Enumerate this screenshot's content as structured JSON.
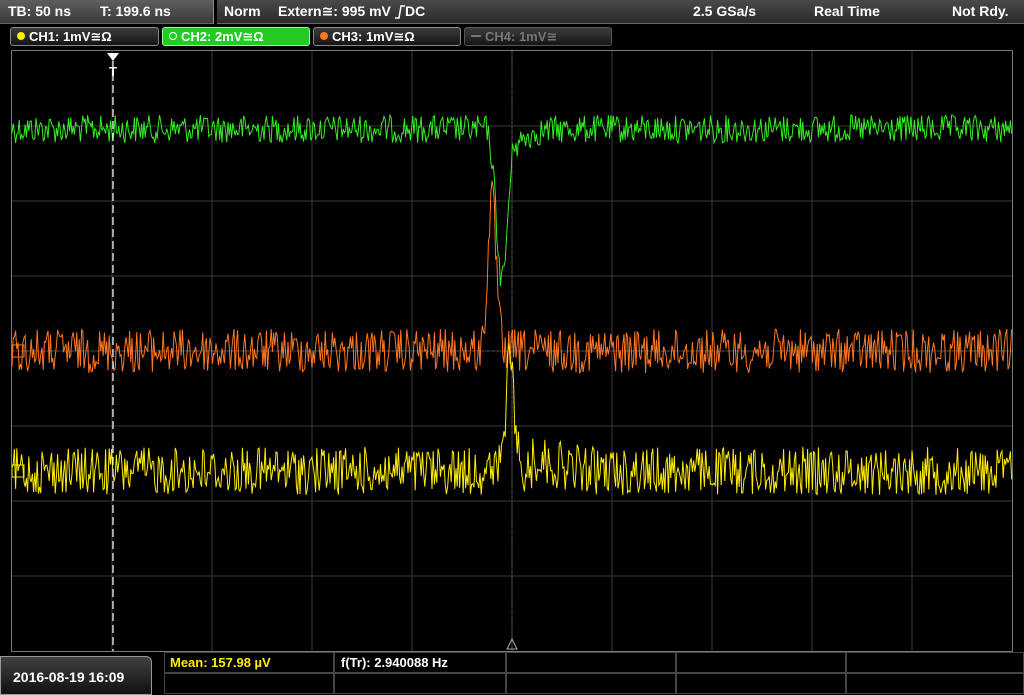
{
  "status": {
    "timebase": "TB: 50 ns",
    "trigger_time": "T: 199.6 ns",
    "mode": "Norm",
    "trigger_source": "Extern≅: 995 mV",
    "trigger_slope_coupling": "DC",
    "sample_rate": "2.5 GSa/s",
    "acq_mode": "Real Time",
    "state": "Not Rdy."
  },
  "channels": [
    {
      "label": "CH1: 1mV≅Ω",
      "color": "#ffee00",
      "active": false,
      "enabled": true
    },
    {
      "label": "CH2: 2mV≅Ω",
      "color": "#22cc22",
      "active": true,
      "enabled": true
    },
    {
      "label": "CH3: 1mV≅Ω",
      "color": "#ff7722",
      "active": false,
      "enabled": true
    },
    {
      "label": "CH4: 1mV≅",
      "color": "#777777",
      "active": false,
      "enabled": false
    }
  ],
  "trace_colors": {
    "ch1": "#ffee00",
    "ch2": "#33ee22",
    "ch3": "#ff7722"
  },
  "trigger_marker": "T",
  "date": "2016-08-19 16:09",
  "measurements": {
    "mean_label": "Mean: 157.98 µV",
    "freq_label": "f(Tr): 2.940088 Hz"
  }
}
